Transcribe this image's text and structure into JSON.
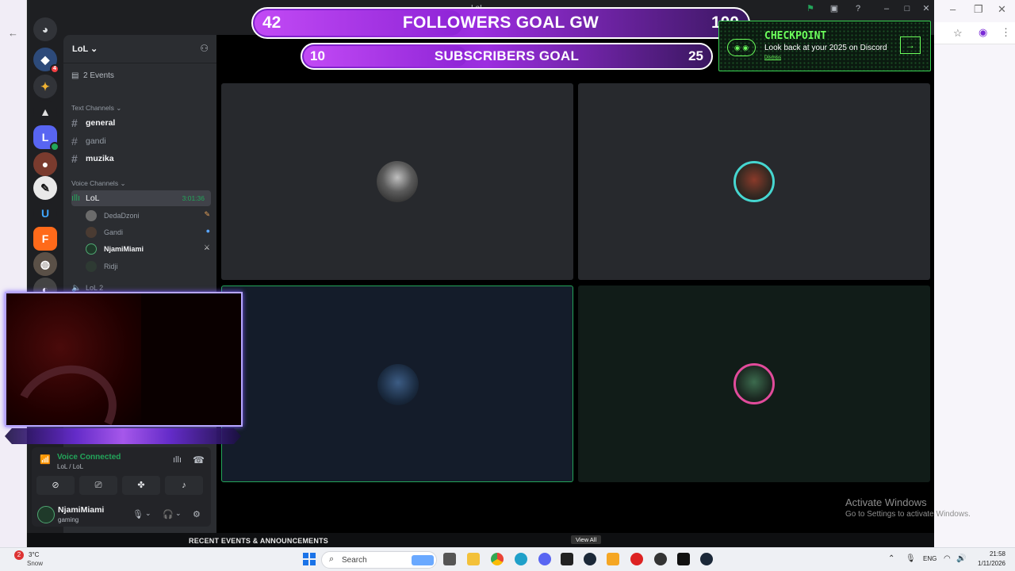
{
  "window": {
    "title": "LoL"
  },
  "server": {
    "name": "LoL",
    "events_label": "2 Events"
  },
  "categories": {
    "text": "Text Channels",
    "voice": "Voice Channels"
  },
  "text_channels": [
    {
      "name": "general",
      "unread": true
    },
    {
      "name": "gandi",
      "unread": false
    },
    {
      "name": "muzika",
      "unread": true
    }
  ],
  "voice_channel": {
    "name": "LoL",
    "timer": "3:01:36",
    "users": [
      {
        "name": "DedaDzoni",
        "status_icon": "pencil-icon",
        "status_color": "#e8a35a"
      },
      {
        "name": "Gandi",
        "status_icon": "chat-bubble-icon",
        "status_color": "#5aa6ff"
      },
      {
        "name": "NjamiMiami",
        "status_icon": "swords-icon",
        "status_color": "#dddddd"
      },
      {
        "name": "Ridji",
        "status_icon": "",
        "status_color": ""
      }
    ],
    "next_channel": "LoL 2"
  },
  "overlay": {
    "followers_goal": {
      "current": "42",
      "title": "FOLLOWERS GOAL GW",
      "target": "100",
      "progress": 0.42
    },
    "subscribers_goal": {
      "current": "10",
      "title": "SUBSCRIBERS GOAL",
      "target": "25",
      "progress": 0.4
    },
    "checkpoint": {
      "title": "CHECKPOINT",
      "subtitle": "Look back at your 2025 on Discord",
      "link": "Dismiss"
    }
  },
  "voice_panel": {
    "status": "Voice Connected",
    "channel_path": "LoL / LoL"
  },
  "user": {
    "name": "NjamiMiami",
    "status": "gaming"
  },
  "watermark": {
    "title": "Activate Windows",
    "subtitle": "Go to Settings to activate Windows."
  },
  "bottom_bar": {
    "label": "RECENT EVENTS & ANNOUNCEMENTS",
    "view_all": "View All"
  },
  "taskbar": {
    "weather_temp": "3°C",
    "weather_desc": "Snow",
    "weather_badge": "2",
    "search_placeholder": "Search",
    "lang": "ENG",
    "time": "21:58",
    "date": "1/11/2026"
  },
  "colors": {
    "discord_bg": "#1e1f22",
    "sidebar_bg": "#2b2d31",
    "voice_green": "#23a55a",
    "goal_purple": "#8e24d6",
    "checkpoint_green": "#6cff5c"
  }
}
